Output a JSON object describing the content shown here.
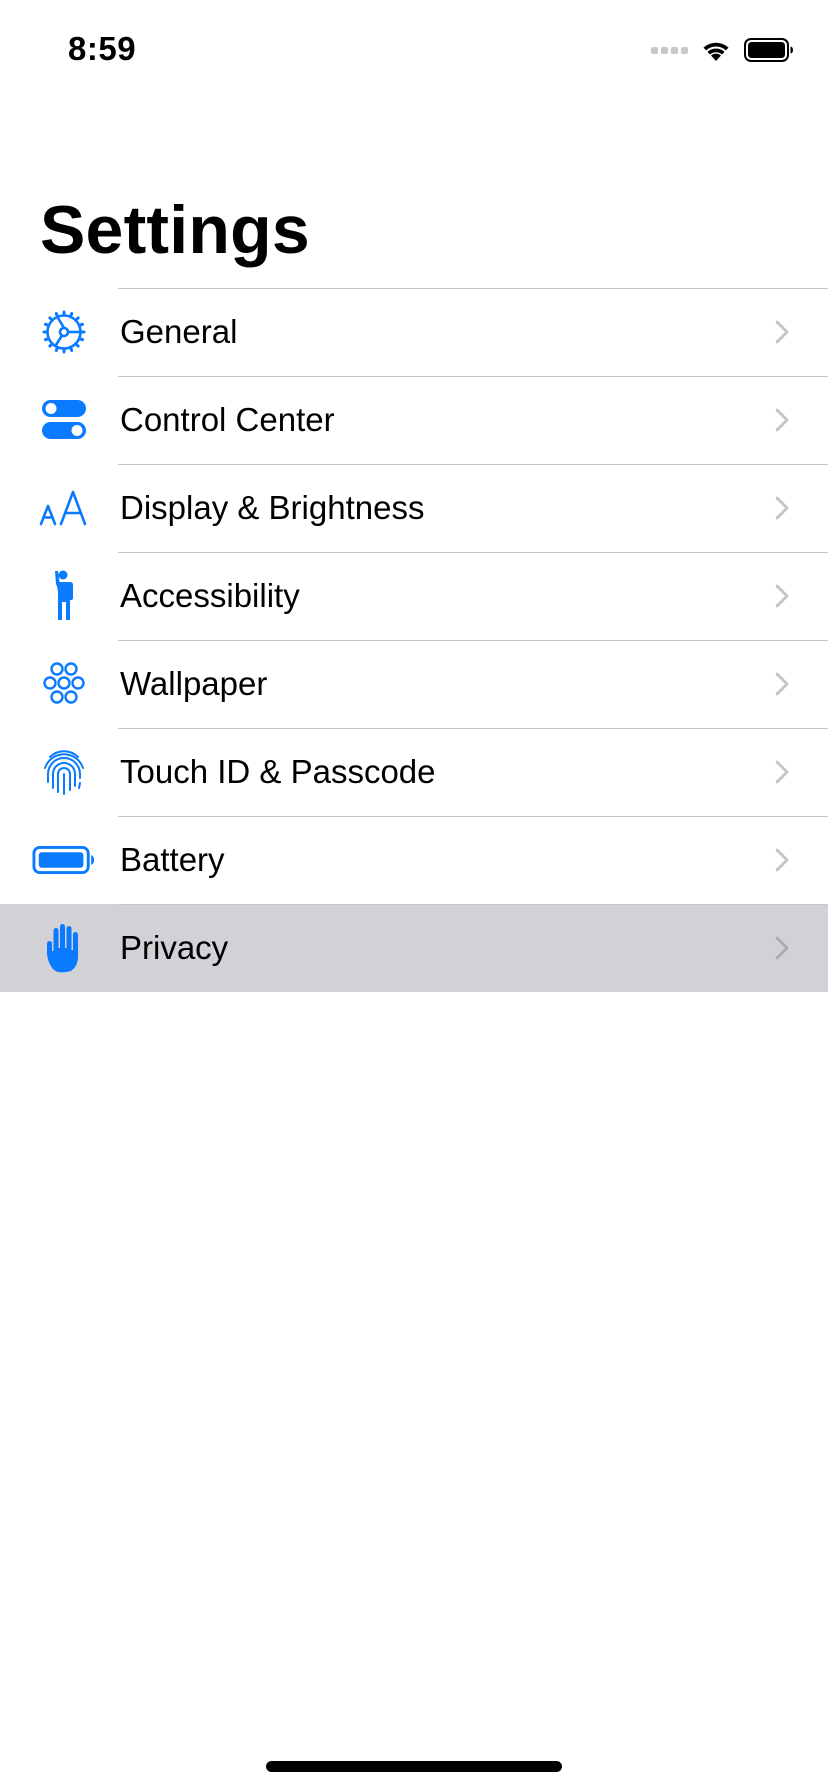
{
  "status_bar": {
    "time": "8:59",
    "signal_icon": "cellular-signal-icon",
    "wifi_icon": "wifi-icon",
    "battery_icon": "battery-icon"
  },
  "page": {
    "title": "Settings"
  },
  "accent_color": "#0a7aff",
  "highlight_color": "#d1d1d6",
  "settings_items": [
    {
      "label": "General",
      "icon": "gear-icon",
      "highlighted": false
    },
    {
      "label": "Control Center",
      "icon": "toggles-icon",
      "highlighted": false
    },
    {
      "label": "Display & Brightness",
      "icon": "text-size-icon",
      "highlighted": false
    },
    {
      "label": "Accessibility",
      "icon": "accessibility-icon",
      "highlighted": false
    },
    {
      "label": "Wallpaper",
      "icon": "flower-icon",
      "highlighted": false
    },
    {
      "label": "Touch ID & Passcode",
      "icon": "fingerprint-icon",
      "highlighted": false
    },
    {
      "label": "Battery",
      "icon": "battery-icon",
      "highlighted": false
    },
    {
      "label": "Privacy",
      "icon": "hand-icon",
      "highlighted": true
    }
  ]
}
